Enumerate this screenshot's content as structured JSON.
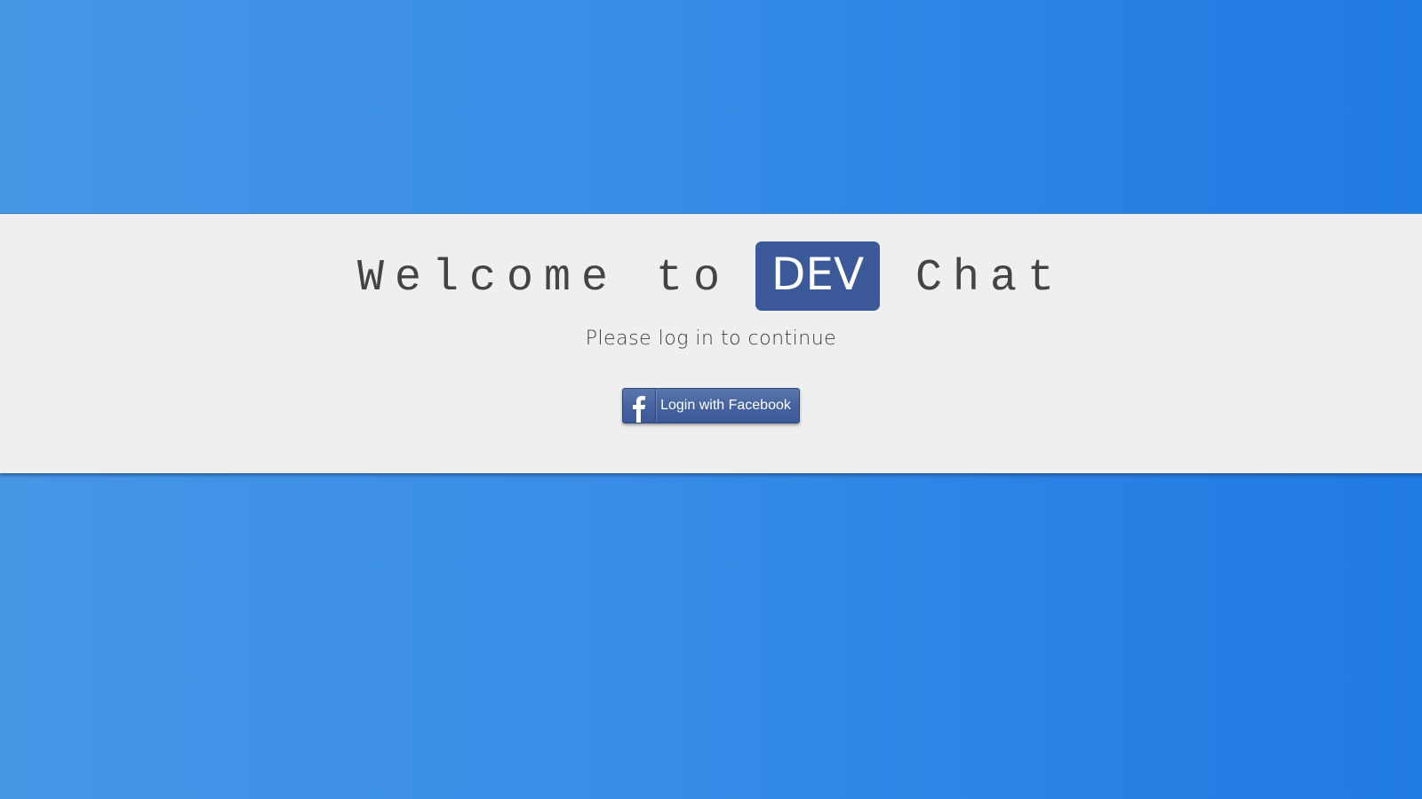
{
  "hero": {
    "title_prefix": "Welcome to",
    "title_badge": "DEV",
    "title_suffix": "Chat",
    "subtitle": "Please log in to continue"
  },
  "login": {
    "facebook_label": "Login with Facebook",
    "icon": "facebook-icon"
  },
  "colors": {
    "background_gradient_start": "#4696e6",
    "background_gradient_end": "#1f7ae2",
    "band": "#efefef",
    "facebook_blue": "#3b5998",
    "title_text": "#444444"
  }
}
